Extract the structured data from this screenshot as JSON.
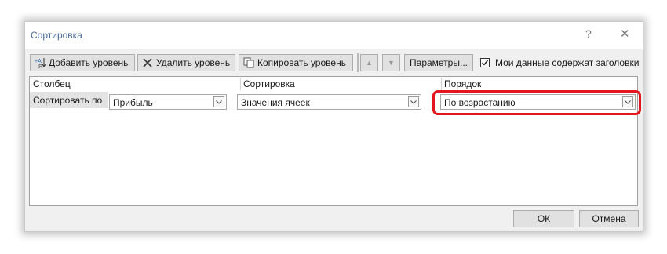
{
  "dialog": {
    "title": "Сортировка",
    "help_glyph": "?",
    "close_glyph": "✕"
  },
  "toolbar": {
    "add_level": "Добавить уровень",
    "delete_level": "Удалить уровень",
    "copy_level": "Копировать уровень",
    "move_up_glyph": "▲",
    "move_down_glyph": "▼",
    "options": "Параметры...",
    "headers_checkbox_label": "Мои данные содержат заголовки",
    "headers_checkbox_checked": true
  },
  "grid": {
    "headers": {
      "column": "Столбец",
      "sort_on": "Сортировка",
      "order": "Порядок"
    },
    "rows": [
      {
        "label": "Сортировать по",
        "column": "Прибыль",
        "sort_on": "Значения ячеек",
        "order": "По возрастанию"
      }
    ]
  },
  "footer": {
    "ok": "ОК",
    "cancel": "Отмена"
  },
  "colors": {
    "highlight": "#e3161d",
    "title_text": "#4b6a92",
    "dialog_bg": "#f0f0f0"
  }
}
